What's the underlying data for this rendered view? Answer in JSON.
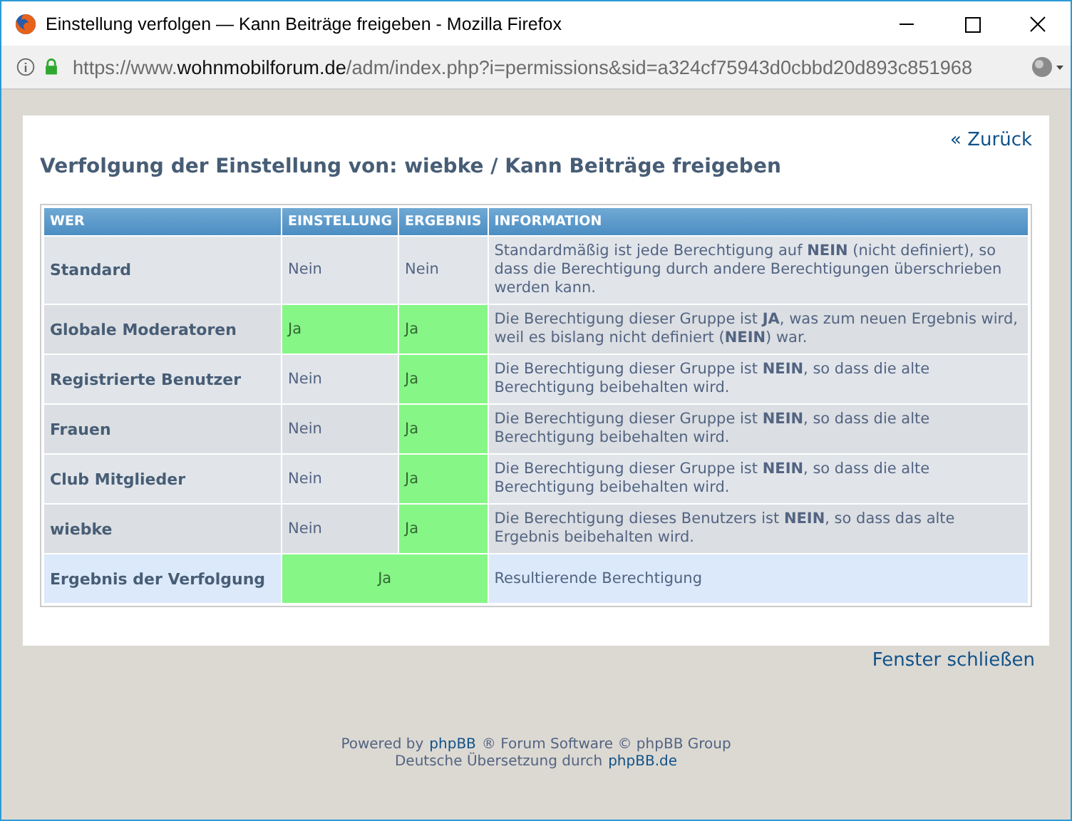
{
  "window": {
    "title": "Einstellung verfolgen — Kann Beiträge freigeben - Mozilla Firefox"
  },
  "address_bar": {
    "prefix": "https://www.",
    "host": "wohnmobilforum.de",
    "path": "/adm/index.php?i=permissions&sid=a324cf75943d0cbbd20d893c851968"
  },
  "back_link": "« Zurück",
  "heading": "Verfolgung der Einstellung von: wiebke / Kann Beiträge freigeben",
  "table": {
    "columns": [
      "WER",
      "EINSTELLUNG",
      "ERGEBNIS",
      "INFORMATION"
    ],
    "rows": [
      {
        "kind": "entry",
        "who": "Standard",
        "setting": {
          "text": "Nein",
          "granted": false
        },
        "result": {
          "text": "Nein",
          "granted": false
        },
        "info": "Standardmäßig ist jede Berechtigung auf **NEIN** (nicht definiert), so dass die Berechtigung durch andere Berechtigungen überschrieben werden kann."
      },
      {
        "kind": "entry",
        "who": "Globale Moderatoren",
        "setting": {
          "text": "Ja",
          "granted": true
        },
        "result": {
          "text": "Ja",
          "granted": true
        },
        "info": "Die Berechtigung dieser Gruppe ist **JA**, was zum neuen Ergebnis wird, weil es bislang nicht definiert (**NEIN**) war."
      },
      {
        "kind": "entry",
        "who": "Registrierte Benutzer",
        "setting": {
          "text": "Nein",
          "granted": false
        },
        "result": {
          "text": "Ja",
          "granted": true
        },
        "info": "Die Berechtigung dieser Gruppe ist **NEIN**, so dass die alte Berechtigung beibehalten wird."
      },
      {
        "kind": "entry",
        "who": "Frauen",
        "setting": {
          "text": "Nein",
          "granted": false
        },
        "result": {
          "text": "Ja",
          "granted": true
        },
        "info": "Die Berechtigung dieser Gruppe ist **NEIN**, so dass die alte Berechtigung beibehalten wird."
      },
      {
        "kind": "entry",
        "who": "Club Mitglieder",
        "setting": {
          "text": "Nein",
          "granted": false
        },
        "result": {
          "text": "Ja",
          "granted": true
        },
        "info": "Die Berechtigung dieser Gruppe ist **NEIN**, so dass die alte Berechtigung beibehalten wird."
      },
      {
        "kind": "entry",
        "who": "wiebke",
        "setting": {
          "text": "Nein",
          "granted": false
        },
        "result": {
          "text": "Ja",
          "granted": true
        },
        "info": "Die Berechtigung dieses Benutzers ist **NEIN**, so dass das alte Ergebnis beibehalten wird."
      },
      {
        "kind": "total",
        "who": "Ergebnis der Verfolgung",
        "result": {
          "text": "Ja",
          "granted": true
        },
        "info": "Resultierende Berechtigung"
      }
    ]
  },
  "close_link": "Fenster schließen",
  "footer": [
    [
      {
        "text": "Powered by",
        "link": false
      },
      {
        "text": "phpBB",
        "link": true
      },
      {
        "text": "® Forum Software © phpBB Group",
        "link": false
      }
    ],
    [
      {
        "text": "Deutsche Übersetzung durch",
        "link": false
      },
      {
        "text": "phpBB.de",
        "link": true
      }
    ]
  ]
}
